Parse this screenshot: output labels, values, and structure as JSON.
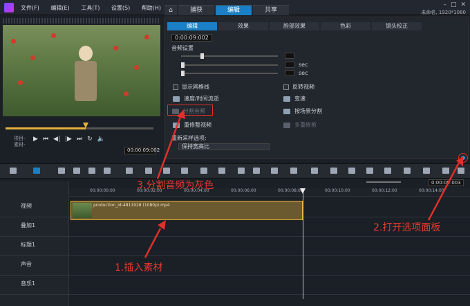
{
  "titlebar": {
    "menu": [
      "文件(F)",
      "编辑(E)",
      "工具(T)",
      "设置(S)",
      "帮助(H)"
    ],
    "tabs": [
      "捕获",
      "编辑",
      "共享"
    ],
    "window_name": "未命名, 1920*1080"
  },
  "preview": {
    "label_project": "项目-",
    "label_clip": "素材-",
    "timecode": "00:00:09:002"
  },
  "options": {
    "tabs": [
      "编辑",
      "效果",
      "脸部效果",
      "色彩",
      "镜头校正"
    ],
    "timecode": "0:00:09:002",
    "audio_section": "音频设置",
    "sec_label": "sec",
    "checkboxes": [
      "显示网格线",
      "反转视频"
    ],
    "items_left": [
      "速度/时间流逝",
      "分割音频",
      "重修整视频"
    ],
    "items_right": [
      "变速",
      "按场景分割",
      "多重修剪"
    ],
    "resample_label": "重新采样选项:",
    "resample_value": "保持宽高比"
  },
  "timeline": {
    "ruler": [
      "00:00:00:00",
      "00:00:02:00",
      "00:00:04:00",
      "00:00:06:00",
      "00:00:08:00",
      "00:00:10:00",
      "00:00:12:00",
      "00:00:14:00"
    ],
    "tracks": [
      "视频",
      "叠加1",
      "标题1",
      "声音",
      "音乐1"
    ],
    "clip_name": "production_id-4811928 (1080p).mp4",
    "zoom_timecode": "0:00:09:003"
  },
  "annotations": {
    "a1": "1.插入素材",
    "a2": "2.打开选项面板",
    "a3": "3.分割音频为灰色"
  }
}
